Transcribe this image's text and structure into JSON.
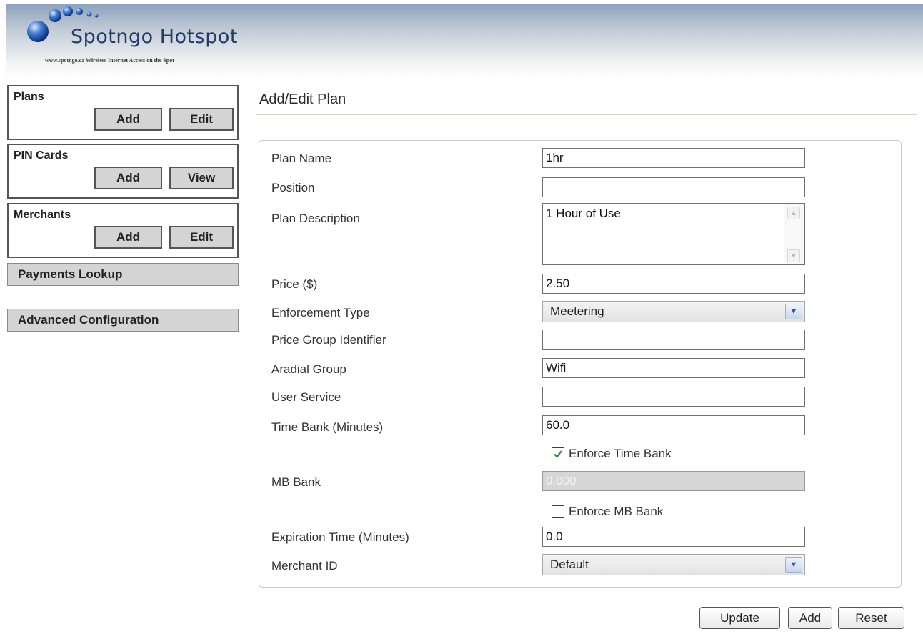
{
  "header": {
    "logo_title": "Spotngo Hotspot",
    "logo_tagline": "www.spotngo.ca   Wireless Internet Access on the Spot"
  },
  "sidebar": {
    "plans": {
      "title": "Plans",
      "add_label": "Add",
      "edit_label": "Edit"
    },
    "pin_cards": {
      "title": "PIN Cards",
      "add_label": "Add",
      "view_label": "View"
    },
    "merchants": {
      "title": "Merchants",
      "add_label": "Add",
      "edit_label": "Edit"
    },
    "payments_lookup_label": "Payments Lookup",
    "advanced_configuration_label": "Advanced Configuration"
  },
  "main": {
    "title": "Add/Edit Plan",
    "form": {
      "plan_name": {
        "label": "Plan Name",
        "value": "1hr"
      },
      "position": {
        "label": "Position",
        "value": ""
      },
      "plan_description": {
        "label": "Plan Description",
        "value": "1 Hour of Use"
      },
      "price": {
        "label": "Price ($)",
        "value": "2.50"
      },
      "enforcement_type": {
        "label": "Enforcement Type",
        "value": "Meetering"
      },
      "price_group_identifier": {
        "label": "Price Group Identifier",
        "value": ""
      },
      "aradial_group": {
        "label": "Aradial Group",
        "value": "Wifi"
      },
      "user_service": {
        "label": "User Service",
        "value": ""
      },
      "time_bank": {
        "label": "Time Bank (Minutes)",
        "value": "60.0"
      },
      "enforce_time_bank": {
        "label": "Enforce Time Bank",
        "checked": true
      },
      "mb_bank": {
        "label": "MB Bank",
        "value": "0.000",
        "disabled": true
      },
      "enforce_mb_bank": {
        "label": "Enforce MB Bank",
        "checked": false
      },
      "expiration_time": {
        "label": "Expiration Time (Minutes)",
        "value": "0.0"
      },
      "merchant_id": {
        "label": "Merchant ID",
        "value": "Default"
      }
    },
    "actions": {
      "update_label": "Update",
      "add_label": "Add",
      "reset_label": "Reset"
    }
  },
  "colors": {
    "header_gradient_top": "#8da2bd",
    "button_gray": "#d4d4d4",
    "check_green": "#2e8b3a",
    "select_arrow_blue": "#3a5a96"
  }
}
